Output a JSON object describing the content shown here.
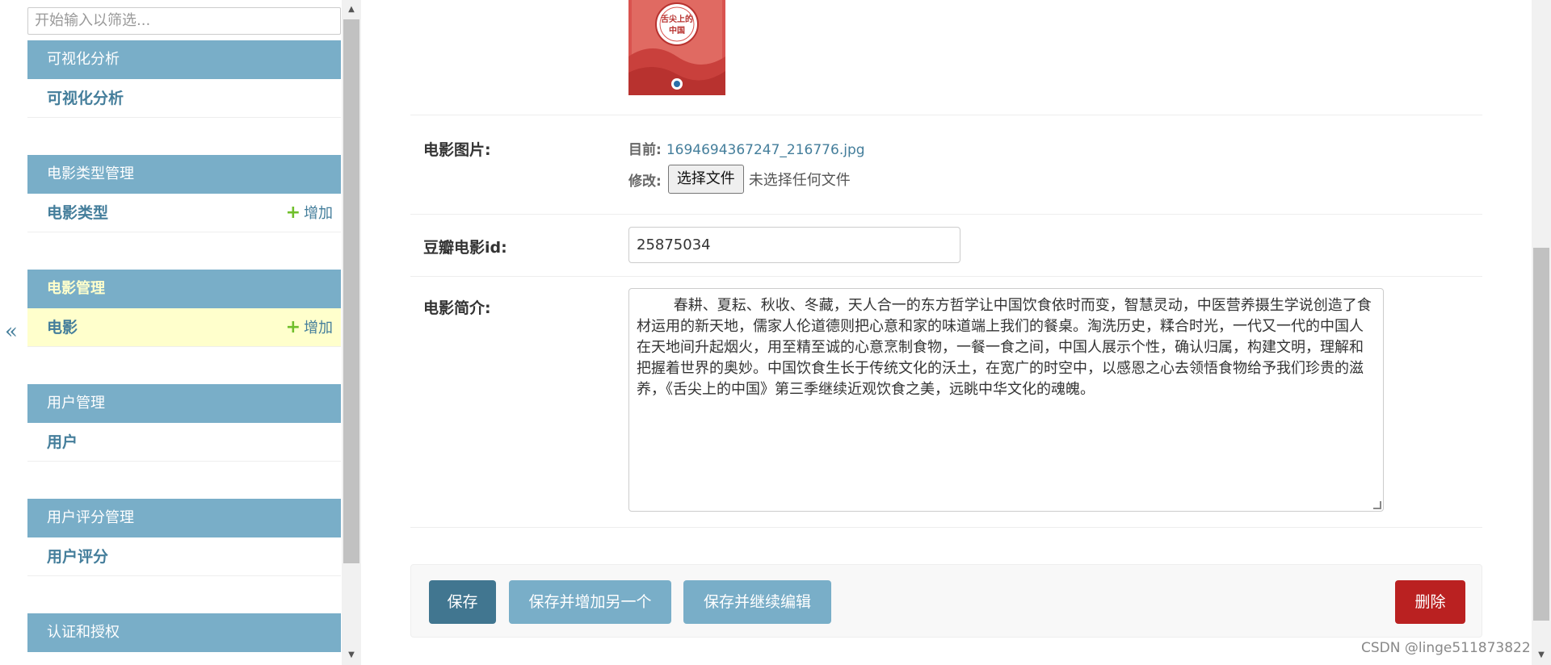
{
  "collapse_toggle": {
    "label": "«"
  },
  "sidebar": {
    "filter_placeholder": "开始输入以筛选...",
    "add_label": "增加",
    "modules": [
      {
        "caption": "可视化分析",
        "active": false,
        "items": [
          {
            "label": "可视化分析",
            "add": false,
            "current": false
          }
        ]
      },
      {
        "caption": "电影类型管理",
        "active": false,
        "items": [
          {
            "label": "电影类型",
            "add": true,
            "current": false
          }
        ]
      },
      {
        "caption": "电影管理",
        "active": true,
        "items": [
          {
            "label": "电影",
            "add": true,
            "current": true
          }
        ]
      },
      {
        "caption": "用户管理",
        "active": false,
        "items": [
          {
            "label": "用户",
            "add": false,
            "current": false
          }
        ]
      },
      {
        "caption": "用户评分管理",
        "active": false,
        "items": [
          {
            "label": "用户评分",
            "add": false,
            "current": false
          }
        ]
      },
      {
        "caption": "认证和授权",
        "active": false,
        "items": []
      }
    ]
  },
  "poster": {
    "title_line1": "舌尖上的",
    "title_line2": "中国"
  },
  "form": {
    "image": {
      "label": "电影图片:",
      "current_label": "目前:",
      "current_file": "1694694367247_216776.jpg",
      "change_label": "修改:",
      "choose_button": "选择文件",
      "no_file_text": "未选择任何文件"
    },
    "douban_id": {
      "label": "豆瓣电影id:",
      "value": "25875034"
    },
    "description": {
      "label": "电影简介:",
      "value": "        春耕、夏耘、秋收、冬藏，天人合一的东方哲学让中国饮食依时而变，智慧灵动，中医营养摄生学说创造了食材运用的新天地，儒家人伦道德则把心意和家的味道端上我们的餐桌。淘洗历史，糅合时光，一代又一代的中国人在天地间升起烟火，用至精至诚的心意烹制食物，一餐一食之间，中国人展示个性，确认归属，构建文明，理解和把握着世界的奥妙。中国饮食生长于传统文化的沃土，在宽广的时空中，以感恩之心去领悟食物给予我们珍贵的滋养，《舌尖上的中国》第三季继续近观饮食之美，远眺中华文化的魂魄。"
    }
  },
  "submit": {
    "save": "保存",
    "save_add": "保存并增加另一个",
    "save_continue": "保存并继续编辑",
    "delete": "删除"
  },
  "watermark": "CSDN @linge511873822",
  "colors": {
    "module_header": "#79aec8",
    "link": "#447e9b",
    "current_row": "#ffffcc",
    "save_button": "#417690",
    "delete_button": "#ba2121",
    "add_plus": "#70bf2b"
  }
}
